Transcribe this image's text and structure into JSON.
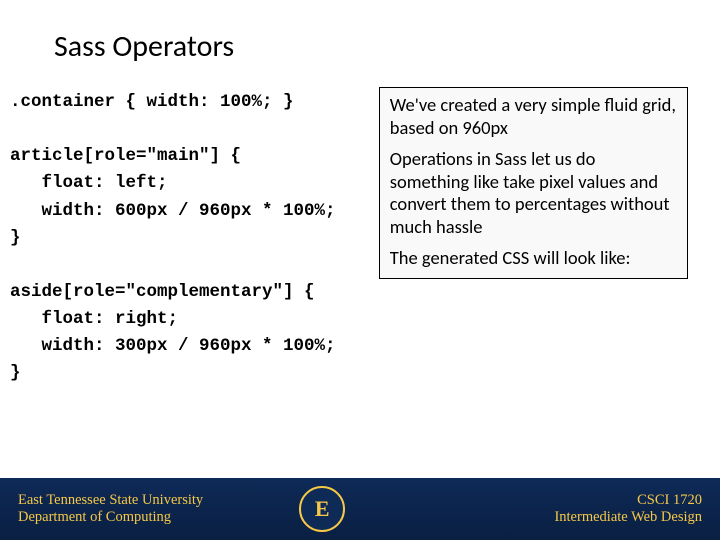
{
  "title": "Sass Operators",
  "code": {
    "line1": ".container { width: 100%; }",
    "line2": "",
    "line3": "article[role=\"main\"] {",
    "line4": "   float: left;",
    "line5": "   width: 600px / 960px * 100%;",
    "line6": "}",
    "line7": "",
    "line8": "aside[role=\"complementary\"] {",
    "line9": "   float: right;",
    "line10": "   width: 300px / 960px * 100%;",
    "line11": "}"
  },
  "explain": {
    "p1": "We've created a very simple fluid grid, based on 960px",
    "p2": "Operations in Sass let us do something like take pixel values and convert them to percentages without much hassle",
    "p3": "The generated CSS will look like:"
  },
  "footer": {
    "uni": "East Tennessee State University",
    "dept": "Department of Computing",
    "logo": "E",
    "course_code": "CSCI 1720",
    "course_name": "Intermediate Web Design"
  }
}
